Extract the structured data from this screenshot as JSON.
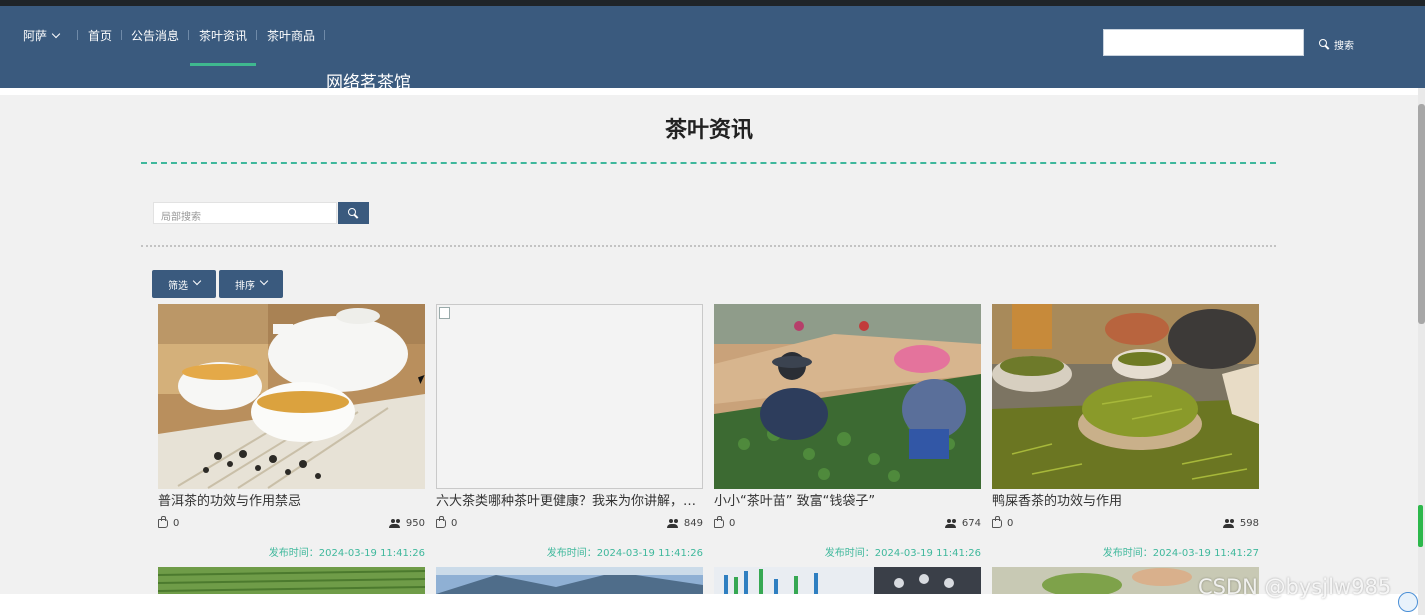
{
  "nav": {
    "user": "阿萨",
    "items": [
      "首页",
      "公告消息",
      "茶叶资讯",
      "茶叶商品"
    ],
    "site_title": "网络茗茶馆",
    "search_value": "",
    "search_label": "搜索"
  },
  "page": {
    "title": "茶叶资讯",
    "local_search_placeholder": "局部搜索",
    "filter_label": "筛选",
    "sort_label": "排序"
  },
  "articles": [
    {
      "title": "普洱茶的功效与作用禁忌",
      "likes": "0",
      "views": "950",
      "date": "发布时间：2024-03-19 11:41:26"
    },
    {
      "title": "六大茶类哪种茶叶更健康？我来为你讲解，…",
      "likes": "0",
      "views": "849",
      "date": "发布时间：2024-03-19 11:41:26"
    },
    {
      "title": "小小“茶叶苗” 致富“钱袋子”",
      "likes": "0",
      "views": "674",
      "date": "发布时间：2024-03-19 11:41:26"
    },
    {
      "title": "鸭屎香茶的功效与作用",
      "likes": "0",
      "views": "598",
      "date": "发布时间：2024-03-19 11:41:27"
    }
  ],
  "watermark": "CSDN @bysjlw985",
  "colors": {
    "nav_bg": "#3a5a7e",
    "accent": "#3fb89c",
    "page_bg": "#f1f1f1"
  }
}
